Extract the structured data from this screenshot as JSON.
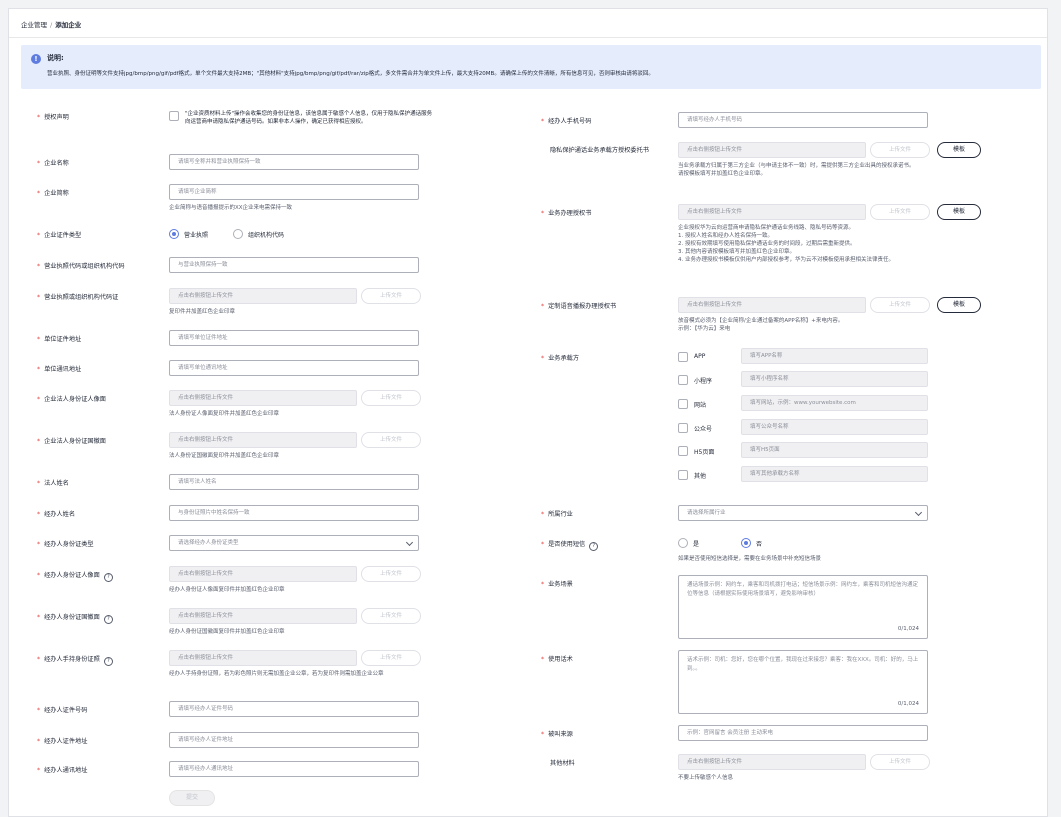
{
  "breadcrumb": {
    "parent": "企业管理",
    "separator": "/",
    "current": "添加企业"
  },
  "notice": {
    "title": "说明:",
    "text": "营业执照、身份证明等文件支持jpg/bmp/png/gif/pdf格式，单个文件最大支持2MB；\"其他材料\"支持jpg/bmp/png/gif/pdf/rar/zip格式，多文件需合并为单文件上传，最大支持20MB。请确保上传的文件清晰，所有信息可见，否则审核由请将驳回。"
  },
  "common": {
    "upload_placeholder": "点击右侧按钮上传文件",
    "upload_btn": "上传文件",
    "template_btn": "模板"
  },
  "left": {
    "auth": {
      "label": "授权声明",
      "text": "\"企业资质材料上传\"操作会收集您的身份证信息，该信息属于敏感个人信息，仅用于隐私保护通话服务向运营商申请隐私保护通话号码。如果非本人操作，确定已获得相应授权。"
    },
    "company_name": {
      "label": "企业名称",
      "placeholder": "请填写全称并和营业执照保持一致"
    },
    "company_short": {
      "label": "企业简称",
      "placeholder": "请填写企业简称",
      "desc": "企业简称与语音播报提示的XX企业来电需保持一致"
    },
    "cert_type": {
      "label": "企业证件类型",
      "opt1": "营业执照",
      "opt2": "组织机构代码"
    },
    "license_code": {
      "label": "营业执照代码或组织机构代码",
      "placeholder": "与营业执照保持一致"
    },
    "license_file": {
      "label": "营业执照或组织机构代码证",
      "desc": "复印件并加盖红色企业印章"
    },
    "unit_addr": {
      "label": "单位证件地址",
      "placeholder": "请填写单位证件地址"
    },
    "unit_mail": {
      "label": "单位通讯地址",
      "placeholder": "请填写单位通讯地址"
    },
    "legal_front": {
      "label": "企业法人身份证人像面",
      "desc": "法人身份证人像面复印件并加盖红色企业印章"
    },
    "legal_back": {
      "label": "企业法人身份证国徽面",
      "desc": "法人身份证国徽面复印件并加盖红色企业印章"
    },
    "legal_name": {
      "label": "法人姓名",
      "placeholder": "请填写法人姓名"
    },
    "agent_name": {
      "label": "经办人姓名",
      "placeholder": "与身份证照片中姓名保持一致"
    },
    "agent_id_type": {
      "label": "经办人身份证类型",
      "placeholder": "请选择经办人身份证类型"
    },
    "agent_front": {
      "label": "经办人身份证人像面",
      "desc": "经办人身份证人像面复印件并加盖红色企业印章"
    },
    "agent_back": {
      "label": "经办人身份证国徽面",
      "desc": "经办人身份证国徽面复印件并加盖红色企业印章"
    },
    "agent_hold": {
      "label": "经办人手持身份证照",
      "desc": "经办人手持身份证照，若为彩色照片则无需加盖企业公章，若为复印件则需加盖企业公章"
    },
    "agent_id_no": {
      "label": "经办人证件号码",
      "placeholder": "请填写经办人证件号码"
    },
    "agent_id_addr": {
      "label": "经办人证件地址",
      "placeholder": "请填写经办人证件地址"
    },
    "agent_mail": {
      "label": "经办人通讯地址",
      "placeholder": "请填写经办人通讯地址"
    },
    "submit": "提交"
  },
  "right": {
    "agent_phone": {
      "label": "经办人手机号码",
      "placeholder": "请填写经办人手机号码"
    },
    "privacy_auth": {
      "label": "隐私保护通话业务承载方授权委托书",
      "desc": "当业务承载方归属于第三方企业（与申请主体不一致）时，需提供第三方企业出具的授权承诺书。\n请按模板填写并加盖红色企业印章。"
    },
    "biz_auth": {
      "label": "业务办理授权书",
      "desc": "企业授权华为云向运营商申请隐私保护通话业务线路、隐私号码等资源。\n1. 授权人姓名和经办人姓名保持一致。\n2. 授权有效期填写使用隐私保护通话业务的时间段，过期后需重新提供。\n3. 其他内容请按模板填写并加盖红色企业印章。\n4. 业务办理授权书模板仅供用户内部授权参考，华为云不对模板使用承担相关法律责任。"
    },
    "voice_auth": {
      "label": "定制语音播报办理授权书",
      "desc": "放音模式必须为【企业简称/企业通过备案的APP名称】+来电内容。\n示例：【华为云】来电"
    },
    "carrier": {
      "label": "业务承载方",
      "items": [
        {
          "name": "APP",
          "placeholder": "填写APP名称"
        },
        {
          "name": "小程序",
          "placeholder": "填写小程序名称"
        },
        {
          "name": "网站",
          "placeholder": "填写网站，示例：www.yourwebsite.com"
        },
        {
          "name": "公众号",
          "placeholder": "填写公众号名称"
        },
        {
          "name": "H5页面",
          "placeholder": "填写H5页面"
        },
        {
          "name": "其他",
          "placeholder": "填写其他承载方名称"
        }
      ]
    },
    "industry": {
      "label": "所属行业",
      "placeholder": "请选择所属行业"
    },
    "sms": {
      "label": "是否使用短信",
      "yes": "是",
      "no": "否",
      "desc": "如果是否使用短信选择是，需要在业务场景中补充短信场景"
    },
    "scene": {
      "label": "业务场景",
      "placeholder": "通话场景示例：网约车，乘客和司机拨打电话；短信场景示例：网约车，乘客和司机短信沟通定位等信息（请根据实际使用场景填写，避免影响审核）",
      "count": "0/1,024"
    },
    "script": {
      "label": "使用话术",
      "placeholder": "话术示例：司机：您好，您在哪个位置，我现在过来接您？乘客：我在XXX。司机：好的，马上到。。",
      "count": "0/1,024"
    },
    "callee_source": {
      "label": "被叫来源",
      "placeholder": "示例：官网留言 会员注册 主动来电"
    },
    "other": {
      "label": "其他材料",
      "desc": "不要上传敏感个人信息"
    }
  }
}
